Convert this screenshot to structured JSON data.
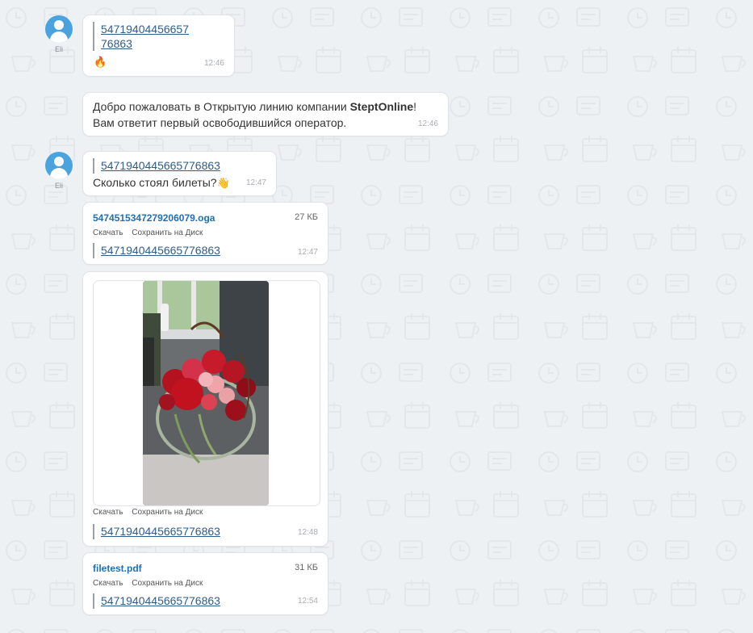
{
  "messages": [
    {
      "sender": "Eli",
      "quote_lines": [
        "54719404456657",
        "76863"
      ],
      "emoji": "🔥",
      "time": "12:46"
    },
    {
      "text_before": "Добро пожаловать в Открытую линию компании ",
      "text_bold": "SteptOnline",
      "text_after": "!",
      "line2": "Вам ответит первый освободившийся оператор.",
      "time": "12:46"
    },
    {
      "sender": "Eli",
      "quote": "5471940445665776863",
      "text": "Сколько стоял билеты?",
      "emoji": "👋",
      "time": "12:47"
    },
    {
      "file_name": "5474515347279206079.oga",
      "file_size": "27 КБ",
      "download": "Скачать",
      "save": "Сохранить на Диск",
      "quote": "5471940445665776863",
      "time": "12:47"
    },
    {
      "image_alt": "flower bouquet photo",
      "download": "Скачать",
      "save": "Сохранить на Диск",
      "quote": "5471940445665776863",
      "time": "12:48"
    },
    {
      "file_name": "filetest.pdf",
      "file_size": "31 КБ",
      "download": "Скачать",
      "save": "Сохранить на Диск",
      "quote": "5471940445665776863",
      "time": "12:54"
    }
  ]
}
